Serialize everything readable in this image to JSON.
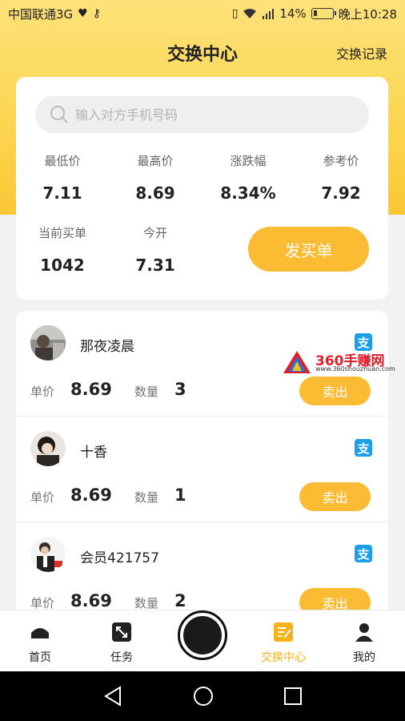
{
  "status_bar": {
    "carrier": "中国联通3G",
    "battery": "14%",
    "time": "晚上10:28"
  },
  "header": {
    "title": "交换中心",
    "history_link": "交换记录"
  },
  "search": {
    "placeholder": "输入对方手机号码"
  },
  "stats": {
    "min_price": {
      "label": "最低价",
      "value": "7.11"
    },
    "max_price": {
      "label": "最高价",
      "value": "8.69"
    },
    "change": {
      "label": "涨跌幅",
      "value": "8.34%"
    },
    "ref_price": {
      "label": "参考价",
      "value": "7.92"
    },
    "current_orders": {
      "label": "当前买单",
      "value": "1042"
    },
    "today_open": {
      "label": "今开",
      "value": "7.31"
    }
  },
  "buy_button": "发买单",
  "orders": [
    {
      "name": "那夜凌晨",
      "price_label": "单价",
      "price": "8.69",
      "qty_label": "数量",
      "qty": "3",
      "sell_label": "卖出",
      "pay_icon": "支"
    },
    {
      "name": "十香",
      "price_label": "单价",
      "price": "8.69",
      "qty_label": "数量",
      "qty": "1",
      "sell_label": "卖出",
      "pay_icon": "支"
    },
    {
      "name": "会员421757",
      "price_label": "单价",
      "price": "8.69",
      "qty_label": "数量",
      "qty": "2",
      "sell_label": "卖出",
      "pay_icon": "支"
    }
  ],
  "watermark": {
    "text": "360手赚网",
    "url": "www.360shouzhuan.com"
  },
  "tabs": [
    {
      "label": "首页",
      "icon": "home-icon"
    },
    {
      "label": "任务",
      "icon": "task-icon"
    },
    {
      "label": "交换中心",
      "icon": "exchange-icon"
    },
    {
      "label": "我的",
      "icon": "profile-icon"
    }
  ],
  "colors": {
    "accent": "#fbbc34",
    "active_tab": "#f5b21b",
    "alipay": "#1aa0e8"
  }
}
